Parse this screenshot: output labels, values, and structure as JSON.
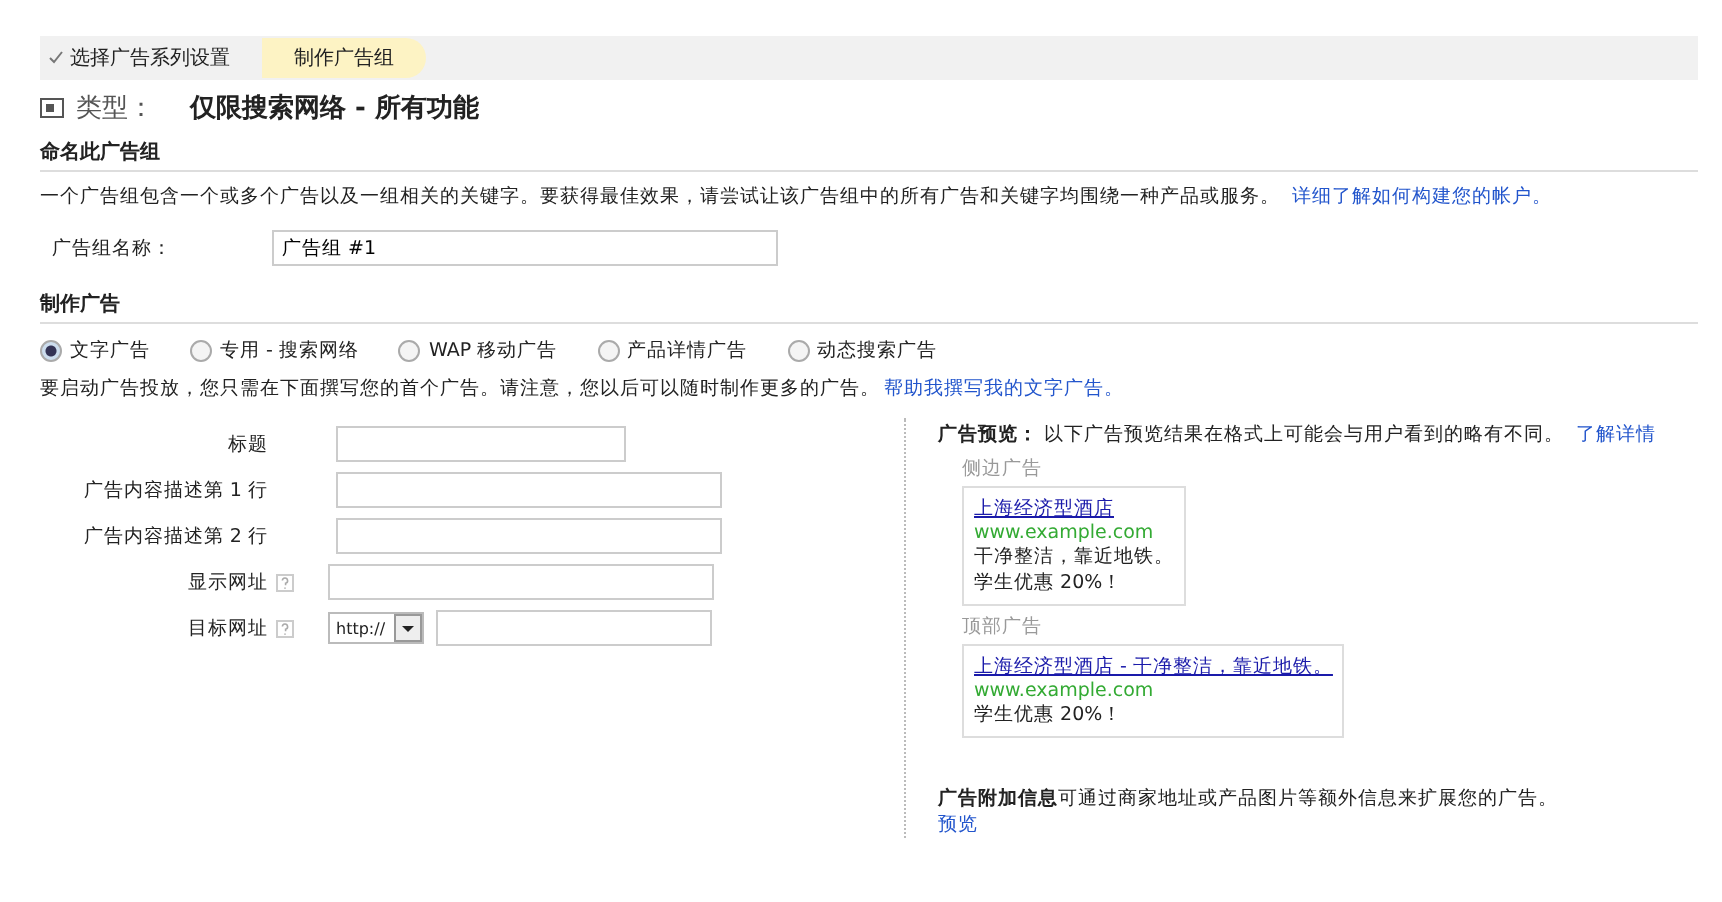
{
  "breadcrumb": [
    {
      "label": "选择广告系列设置",
      "done": true,
      "selected": false
    },
    {
      "label": "制作广告组",
      "done": false,
      "selected": true
    }
  ],
  "type_heading": {
    "label": "类型：",
    "value": "仅限搜索网络 - 所有功能"
  },
  "name_section": {
    "title": "命名此广告组",
    "description": "一个广告组包含一个或多个广告以及一组相关的关键字。要获得最佳效果，请尝试让该广告组中的所有广告和关键字均围绕一种产品或服务。",
    "link": "详细了解如何构建您的帐户。",
    "field_label": "广告组名称：",
    "field_value": "广告组 #1"
  },
  "ad_section": {
    "title": "制作广告",
    "ad_types": [
      {
        "label": "文字广告",
        "selected": true
      },
      {
        "label": "专用 - 搜索网络",
        "selected": false
      },
      {
        "label": "WAP 移动广告",
        "selected": false
      },
      {
        "label": "产品详情广告",
        "selected": false
      },
      {
        "label": "动态搜索广告",
        "selected": false
      }
    ],
    "intro": "要启动广告投放，您只需在下面撰写您的首个广告。请注意，您以后可以随时制作更多的广告。",
    "intro_link": "帮助我撰写我的文字广告。",
    "fields": [
      {
        "label": "标题",
        "kind": "text",
        "help": false
      },
      {
        "label": "广告内容描述第 1 行",
        "kind": "text",
        "help": false
      },
      {
        "label": "广告内容描述第 2 行",
        "kind": "text",
        "help": false
      },
      {
        "label": "显示网址",
        "kind": "text",
        "help": true
      },
      {
        "label": "目标网址",
        "kind": "url",
        "help": true,
        "protocol": "http://"
      }
    ]
  },
  "preview": {
    "title": "广告预览：",
    "note": "以下广告预览结果在格式上可能会与用户看到的略有不同。",
    "link": "了解详情",
    "ads": [
      {
        "caption": "侧边广告",
        "headline": "上海经济型酒店",
        "url": "www.example.com",
        "lines": [
          "干净整洁，靠近地铁。",
          "学生优惠 20%！"
        ]
      },
      {
        "caption": "顶部广告",
        "headline": "上海经济型酒店 - 干净整洁，靠近地铁。",
        "url": "www.example.com",
        "lines": [
          "学生优惠 20%！"
        ]
      }
    ],
    "extensions": "**广告附加信息**可通过商家地址或产品图片等额外信息来扩展您的广告。",
    "extensions_link": "预览"
  }
}
